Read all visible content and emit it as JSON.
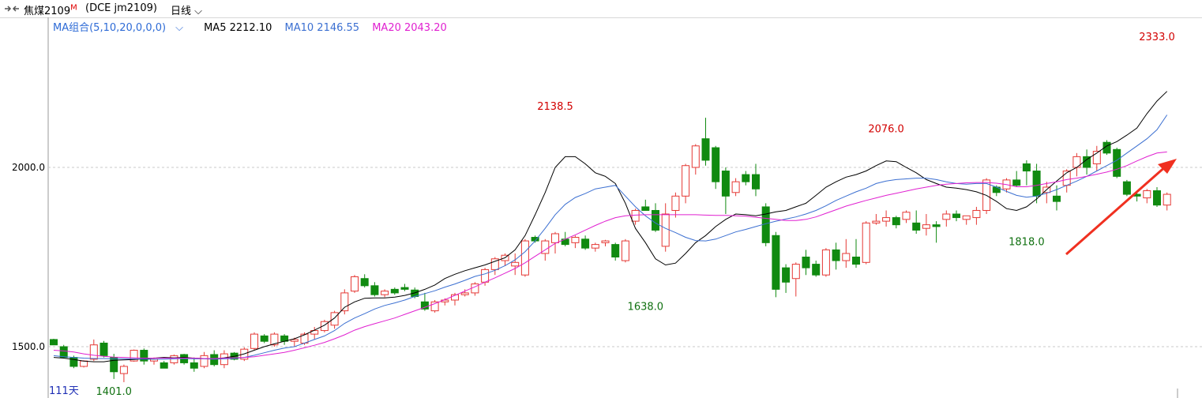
{
  "header": {
    "name": "焦煤2109",
    "marker": "M",
    "code": "(DCE  jm2109)",
    "period": "日线",
    "link_icon": "link-icon",
    "dropdown_icon": "chevron-down-icon"
  },
  "ma_legend": {
    "combo": "MA组合(5,10,20,0,0,0)",
    "ma5": "MA5 2212.10",
    "ma10": "MA10 2146.55",
    "ma20": "MA20 2043.20"
  },
  "footer": {
    "days": "111天"
  },
  "colors": {
    "up": "#e53935",
    "down": "#108a10",
    "ma5": "#000000",
    "ma10": "#3b6fd1",
    "ma20": "#e020d0",
    "annot_high": "#d20000",
    "annot_low": "#107010",
    "arrow": "#f03020"
  },
  "chart_data": {
    "type": "candlestick",
    "ylim": [
      1335,
      2395
    ],
    "y_ticks": [
      1500,
      2000
    ],
    "y_tick_labels": [
      "1500.0",
      "2000.0"
    ],
    "grid": "dashed horizontal at tick levels",
    "annotations": [
      {
        "text": "2138.5",
        "index": 50,
        "value": 2138.5,
        "kind": "high"
      },
      {
        "text": "1638.0",
        "index": 59,
        "value": 1638.0,
        "kind": "low"
      },
      {
        "text": "2076.0",
        "index": 83,
        "value": 2076.0,
        "kind": "high"
      },
      {
        "text": "1818.0",
        "index": 97,
        "value": 1818.0,
        "kind": "low"
      },
      {
        "text": "2333.0",
        "index": 110,
        "value": 2333.0,
        "kind": "high"
      },
      {
        "text": "1401.0",
        "index": 6,
        "value": 1401.0,
        "kind": "low"
      }
    ],
    "series": [
      {
        "name": "MA5",
        "values": [
          1470,
          1468,
          1464,
          1460,
          1458,
          1458,
          1462,
          1463,
          1464,
          1466,
          1468,
          1470,
          1469,
          1470,
          1468,
          1467,
          1466,
          1469,
          1473,
          1480,
          1490,
          1500,
          1508,
          1515,
          1522,
          1533,
          1546,
          1560,
          1580,
          1610,
          1625,
          1635,
          1636,
          1636,
          1638,
          1643,
          1650,
          1660,
          1672,
          1690,
          1702,
          1712,
          1720,
          1728,
          1738,
          1748,
          1770,
          1810,
          1868,
          1930,
          2000,
          2030,
          2030,
          2010,
          1985,
          1975,
          1955,
          1900,
          1830,
          1790,
          1745,
          1728,
          1733,
          1760,
          1790,
          1810,
          1835,
          1855,
          1870,
          1868,
          1865,
          1870,
          1876,
          1880,
          1890,
          1900,
          1922,
          1945,
          1960,
          1973,
          1980,
          1990,
          2005,
          2018,
          2016,
          2000,
          1985,
          1966,
          1955,
          1945,
          1942,
          1938,
          1932,
          1922,
          1905,
          1885,
          1880,
          1890,
          1912,
          1938,
          1962,
          1985,
          2000,
          2022,
          2040,
          2060,
          2072,
          2090,
          2110,
          2150,
          2185,
          2212.1
        ]
      },
      {
        "name": "MA10",
        "values": [
          1475,
          1472,
          1470,
          1468,
          1467,
          1467,
          1466,
          1466,
          1466,
          1465,
          1465,
          1465,
          1466,
          1467,
          1466,
          1466,
          1465,
          1466,
          1467,
          1470,
          1476,
          1483,
          1490,
          1496,
          1500,
          1510,
          1520,
          1530,
          1545,
          1565,
          1580,
          1592,
          1605,
          1615,
          1622,
          1630,
          1640,
          1648,
          1656,
          1666,
          1675,
          1685,
          1696,
          1703,
          1713,
          1726,
          1742,
          1765,
          1795,
          1830,
          1868,
          1897,
          1916,
          1927,
          1940,
          1945,
          1950,
          1920,
          1890,
          1865,
          1845,
          1830,
          1818,
          1805,
          1796,
          1795,
          1800,
          1810,
          1820,
          1827,
          1835,
          1843,
          1850,
          1856,
          1862,
          1870,
          1880,
          1893,
          1908,
          1920,
          1932,
          1942,
          1955,
          1962,
          1966,
          1968,
          1970,
          1970,
          1966,
          1960,
          1955,
          1953,
          1955,
          1955,
          1945,
          1933,
          1922,
          1917,
          1920,
          1928,
          1938,
          1950,
          1962,
          1975,
          1990,
          2005,
          2020,
          2040,
          2060,
          2080,
          2105,
          2146.55
        ]
      },
      {
        "name": "MA20",
        "values": [
          1490,
          1488,
          1485,
          1480,
          1476,
          1473,
          1471,
          1470,
          1469,
          1468,
          1468,
          1468,
          1468,
          1468,
          1468,
          1467,
          1467,
          1468,
          1469,
          1470,
          1472,
          1476,
          1480,
          1484,
          1490,
          1497,
          1504,
          1512,
          1522,
          1533,
          1546,
          1556,
          1564,
          1572,
          1580,
          1590,
          1600,
          1610,
          1620,
          1631,
          1643,
          1655,
          1667,
          1680,
          1692,
          1705,
          1718,
          1734,
          1752,
          1770,
          1788,
          1800,
          1812,
          1825,
          1838,
          1850,
          1860,
          1865,
          1867,
          1868,
          1868,
          1868,
          1868,
          1868,
          1868,
          1867,
          1866,
          1866,
          1865,
          1864,
          1861,
          1858,
          1855,
          1852,
          1852,
          1855,
          1862,
          1872,
          1882,
          1892,
          1900,
          1908,
          1915,
          1922,
          1928,
          1934,
          1940,
          1945,
          1950,
          1953,
          1955,
          1957,
          1958,
          1958,
          1956,
          1952,
          1946,
          1946,
          1950,
          1955,
          1960,
          1966,
          1970,
          1975,
          1981,
          1987,
          1995,
          2005,
          2018,
          2030,
          2040,
          2043.2
        ]
      },
      {
        "name": "OHLC",
        "values": [
          [
            1520,
            1522,
            1505,
            1505
          ],
          [
            1500,
            1505,
            1470,
            1470
          ],
          [
            1470,
            1475,
            1440,
            1445
          ],
          [
            1445,
            1462,
            1442,
            1460
          ],
          [
            1465,
            1520,
            1460,
            1505
          ],
          [
            1510,
            1516,
            1470,
            1475
          ],
          [
            1470,
            1480,
            1410,
            1430
          ],
          [
            1425,
            1450,
            1401,
            1445
          ],
          [
            1460,
            1492,
            1458,
            1490
          ],
          [
            1490,
            1495,
            1450,
            1460
          ],
          [
            1460,
            1470,
            1450,
            1465
          ],
          [
            1455,
            1460,
            1440,
            1440
          ],
          [
            1455,
            1478,
            1450,
            1475
          ],
          [
            1478,
            1480,
            1450,
            1455
          ],
          [
            1455,
            1470,
            1430,
            1440
          ],
          [
            1445,
            1485,
            1440,
            1475
          ],
          [
            1478,
            1490,
            1445,
            1450
          ],
          [
            1450,
            1490,
            1440,
            1480
          ],
          [
            1482,
            1485,
            1462,
            1465
          ],
          [
            1465,
            1498,
            1460,
            1493
          ],
          [
            1495,
            1540,
            1490,
            1535
          ],
          [
            1530,
            1535,
            1510,
            1515
          ],
          [
            1505,
            1540,
            1500,
            1535
          ],
          [
            1530,
            1535,
            1505,
            1515
          ],
          [
            1515,
            1525,
            1500,
            1520
          ],
          [
            1510,
            1540,
            1505,
            1535
          ],
          [
            1535,
            1555,
            1520,
            1545
          ],
          [
            1545,
            1575,
            1540,
            1570
          ],
          [
            1560,
            1600,
            1550,
            1595
          ],
          [
            1600,
            1660,
            1590,
            1650
          ],
          [
            1655,
            1700,
            1650,
            1695
          ],
          [
            1690,
            1702,
            1665,
            1670
          ],
          [
            1670,
            1680,
            1640,
            1645
          ],
          [
            1645,
            1660,
            1638,
            1655
          ],
          [
            1660,
            1665,
            1645,
            1650
          ],
          [
            1665,
            1675,
            1655,
            1660
          ],
          [
            1658,
            1665,
            1635,
            1640
          ],
          [
            1625,
            1650,
            1600,
            1605
          ],
          [
            1600,
            1630,
            1595,
            1625
          ],
          [
            1625,
            1635,
            1615,
            1630
          ],
          [
            1630,
            1650,
            1615,
            1645
          ],
          [
            1645,
            1660,
            1640,
            1650
          ],
          [
            1650,
            1680,
            1642,
            1675
          ],
          [
            1680,
            1720,
            1670,
            1715
          ],
          [
            1715,
            1750,
            1700,
            1745
          ],
          [
            1740,
            1760,
            1725,
            1755
          ],
          [
            1725,
            1760,
            1700,
            1735
          ],
          [
            1700,
            1800,
            1695,
            1795
          ],
          [
            1805,
            1810,
            1790,
            1795
          ],
          [
            1760,
            1800,
            1740,
            1795
          ],
          [
            1790,
            1820,
            1760,
            1815
          ],
          [
            1800,
            1820,
            1780,
            1785
          ],
          [
            1790,
            1810,
            1775,
            1805
          ],
          [
            1800,
            1810,
            1770,
            1775
          ],
          [
            1775,
            1790,
            1765,
            1785
          ],
          [
            1790,
            1798,
            1780,
            1795
          ],
          [
            1785,
            1790,
            1740,
            1750
          ],
          [
            1740,
            1800,
            1735,
            1795
          ],
          [
            1850,
            1885,
            1840,
            1880
          ],
          [
            1890,
            1910,
            1880,
            1880
          ],
          [
            1880,
            1900,
            1820,
            1825
          ],
          [
            1780,
            1900,
            1765,
            1870
          ],
          [
            1880,
            1930,
            1860,
            1920
          ],
          [
            1920,
            2010,
            1900,
            2005
          ],
          [
            2000,
            2065,
            1980,
            2060
          ],
          [
            2080,
            2138.5,
            2005,
            2020
          ],
          [
            2055,
            2060,
            1940,
            1960
          ],
          [
            1990,
            2000,
            1870,
            1920
          ],
          [
            1930,
            1970,
            1920,
            1960
          ],
          [
            1980,
            1990,
            1950,
            1960
          ],
          [
            1980,
            2010,
            1920,
            1940
          ],
          [
            1890,
            1900,
            1780,
            1790
          ],
          [
            1810,
            1820,
            1638,
            1660
          ],
          [
            1720,
            1730,
            1650,
            1680
          ],
          [
            1690,
            1735,
            1640,
            1730
          ],
          [
            1750,
            1770,
            1700,
            1720
          ],
          [
            1730,
            1740,
            1695,
            1700
          ],
          [
            1700,
            1775,
            1695,
            1770
          ],
          [
            1770,
            1790,
            1715,
            1740
          ],
          [
            1740,
            1800,
            1720,
            1760
          ],
          [
            1750,
            1800,
            1720,
            1730
          ],
          [
            1735,
            1850,
            1730,
            1845
          ],
          [
            1845,
            1870,
            1840,
            1850
          ],
          [
            1850,
            1880,
            1835,
            1860
          ],
          [
            1860,
            1865,
            1830,
            1840
          ],
          [
            1855,
            1880,
            1845,
            1875
          ],
          [
            1845,
            1880,
            1815,
            1825
          ],
          [
            1830,
            1870,
            1810,
            1840
          ],
          [
            1840,
            1850,
            1790,
            1835
          ],
          [
            1855,
            1880,
            1835,
            1870
          ],
          [
            1870,
            1880,
            1850,
            1860
          ],
          [
            1855,
            1860,
            1840,
            1865
          ],
          [
            1860,
            1890,
            1840,
            1880
          ],
          [
            1880,
            1970,
            1870,
            1965
          ],
          [
            1945,
            1950,
            1920,
            1930
          ],
          [
            1940,
            1970,
            1930,
            1965
          ],
          [
            1965,
            1990,
            1945,
            1950
          ],
          [
            2010,
            2020,
            1950,
            1990
          ],
          [
            1990,
            2010,
            1900,
            1920
          ],
          [
            1930,
            1960,
            1900,
            1945
          ],
          [
            1920,
            1950,
            1880,
            1905
          ],
          [
            1950,
            1995,
            1930,
            1990
          ],
          [
            2000,
            2040,
            1975,
            2030
          ],
          [
            2030,
            2050,
            1980,
            2000
          ],
          [
            2010,
            2060,
            1990,
            2045
          ],
          [
            2070,
            2076,
            2035,
            2040
          ],
          [
            2050,
            2055,
            1970,
            1975
          ],
          [
            1960,
            1965,
            1920,
            1925
          ],
          [
            1925,
            1935,
            1905,
            1920
          ],
          [
            1915,
            1940,
            1900,
            1935
          ],
          [
            1935,
            1945,
            1890,
            1895
          ],
          [
            1895,
            1930,
            1880,
            1925
          ]
        ]
      }
    ]
  }
}
